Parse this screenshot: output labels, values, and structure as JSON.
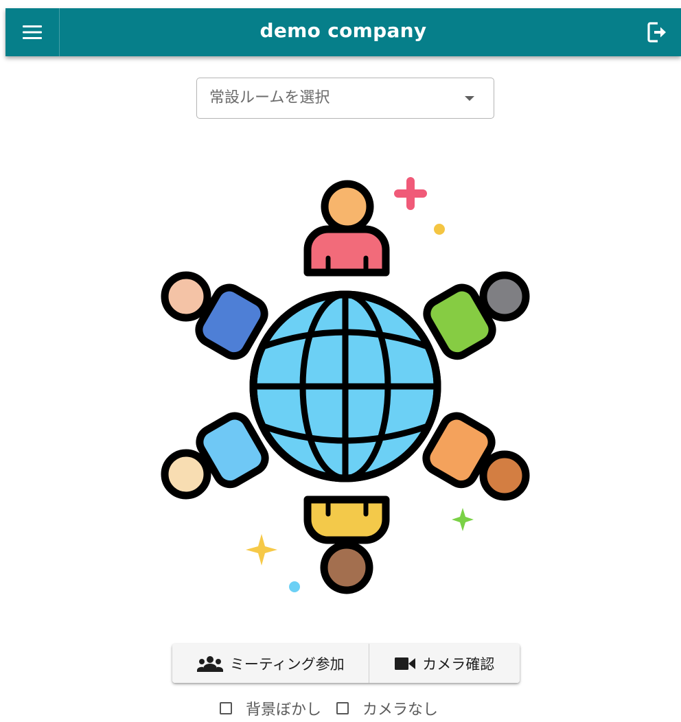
{
  "header": {
    "title": "demo company",
    "menu_icon": "hamburger-menu-icon",
    "logout_icon": "logout-icon",
    "background_color": "#067f8a"
  },
  "room_select": {
    "placeholder": "常設ルームを選択"
  },
  "illustration": {
    "icon": "global-meeting-people-around-globe-illustration"
  },
  "actions": {
    "join_label": "ミーティング参加",
    "join_icon": "group-icon",
    "camera_label": "カメラ確認",
    "camera_icon": "videocam-icon"
  },
  "options": {
    "blur_label": "背景ぼかし",
    "blur_checked": false,
    "nocam_label": "カメラなし",
    "nocam_checked": false
  }
}
